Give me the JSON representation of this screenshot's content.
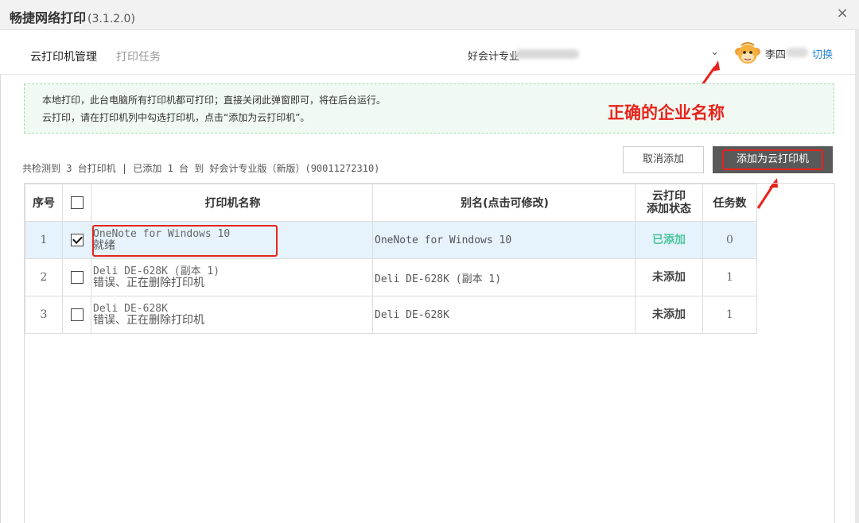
{
  "window": {
    "title": "畅捷网络打印",
    "version": "(3.1.2.0)",
    "close_glyph": "×"
  },
  "nav": {
    "tabs": [
      {
        "label": "云打印机管理",
        "active": true
      },
      {
        "label": "打印任务",
        "active": false
      }
    ],
    "company": "好会计专业",
    "chevron": "⌄",
    "user": "李四",
    "switch_label": "切换"
  },
  "notice": {
    "line1": "本地打印，此台电脑所有打印机都可打印；直接关闭此弹窗即可，将在后台运行。",
    "line2": "云打印，请在打印机列中勾选打印机，点击“添加为云打印机”。"
  },
  "annotation": {
    "text": "正确的企业名称",
    "color": "#e8231c"
  },
  "summary": "共检测到 3 台打印机 | 已添加 1 台 到 好会计专业版（新版）(90011272310)",
  "buttons": {
    "cancel": "取消添加",
    "add": "添加为云打印机"
  },
  "table": {
    "headers": {
      "index": "序号",
      "name": "打印机名称",
      "alias": "别名(点击可修改)",
      "status_l1": "云打印",
      "status_l2": "添加状态",
      "tasks": "任务数"
    },
    "rows": [
      {
        "index": "1",
        "checked": true,
        "name": "OneNote for Windows 10",
        "state": "就绪",
        "alias": "OneNote for Windows 10",
        "status": "已添加",
        "tasks": "0"
      },
      {
        "index": "2",
        "checked": false,
        "name": "Deli DE-628K (副本 1)",
        "state": "错误、正在删除打印机",
        "alias": "Deli DE-628K (副本 1)",
        "status": "未添加",
        "tasks": "1"
      },
      {
        "index": "3",
        "checked": false,
        "name": "Deli DE-628K",
        "state": "错误、正在删除打印机",
        "alias": "Deli DE-628K",
        "status": "未添加",
        "tasks": "1"
      }
    ]
  },
  "colors": {
    "accent": "#2a87d8",
    "added": "#49c59a",
    "annotation": "#e8231c",
    "primary_button": "#595959"
  }
}
